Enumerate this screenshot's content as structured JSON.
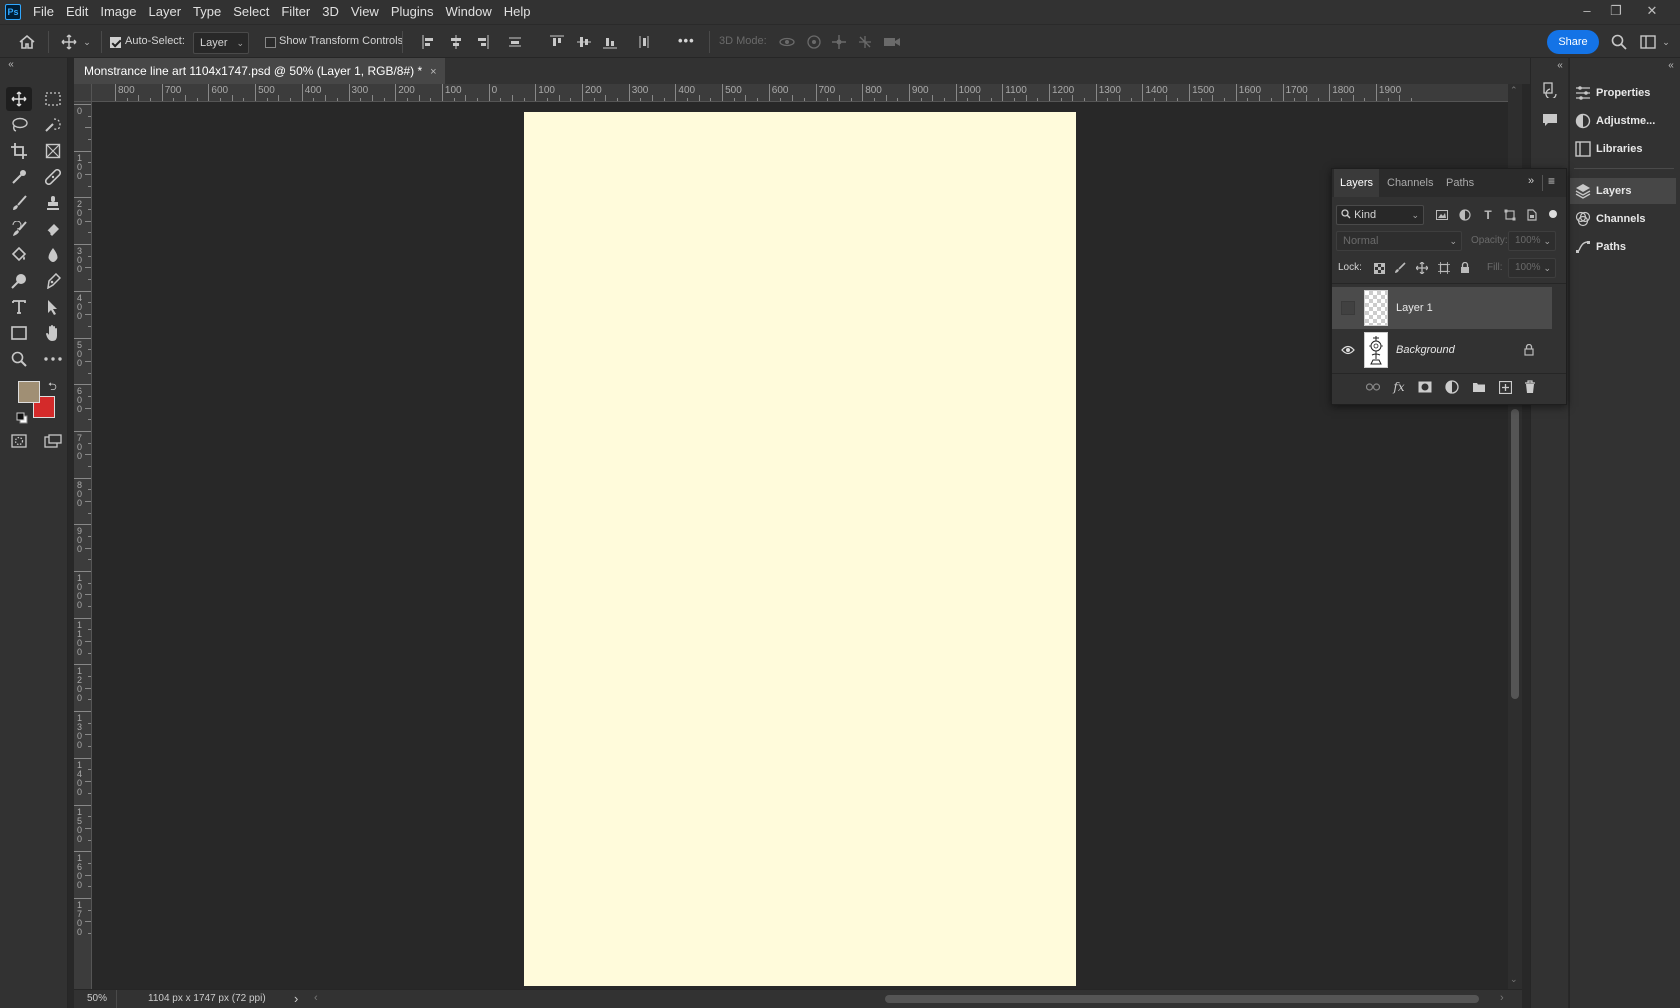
{
  "app": {
    "logo_text": "Ps"
  },
  "menu": [
    "File",
    "Edit",
    "Image",
    "Layer",
    "Type",
    "Select",
    "Filter",
    "3D",
    "View",
    "Plugins",
    "Window",
    "Help"
  ],
  "window_controls": {
    "minimize": "–",
    "restore": "❐",
    "close": "✕"
  },
  "options_bar": {
    "auto_select_label": "Auto-Select:",
    "auto_select_checked": true,
    "auto_select_target": "Layer",
    "show_transform_label": "Show Transform Controls",
    "show_transform_checked": false,
    "more_label": "•••",
    "mode_3d_label": "3D Mode:",
    "share_label": "Share"
  },
  "document": {
    "tab_title": "Monstrance line art 1104x1747.psd @ 50% (Layer 1, RGB/8#) *",
    "close_glyph": "×",
    "canvas_color": "#fffbdb"
  },
  "ruler": {
    "h_labels": [
      "800",
      "700",
      "600",
      "500",
      "400",
      "300",
      "200",
      "100",
      "0",
      "100",
      "200",
      "300",
      "400",
      "500",
      "600",
      "700",
      "800",
      "900",
      "1000",
      "1100",
      "1200",
      "1300",
      "1400",
      "1500",
      "1600",
      "1700",
      "1800",
      "1900"
    ],
    "v_labels": [
      "0",
      "100",
      "200",
      "300",
      "400",
      "500",
      "600",
      "700",
      "800",
      "900",
      "1000",
      "1100",
      "1200",
      "1300",
      "1400",
      "1500",
      "1600",
      "1700"
    ]
  },
  "status": {
    "zoom": "50%",
    "doc_info": "1104 px x 1747 px (72 ppi)",
    "arrow": "›"
  },
  "colors": {
    "foreground": "#a08f74",
    "background": "#d42a2a",
    "accent": "#1473e6"
  },
  "layers_panel": {
    "tabs": [
      "Layers",
      "Channels",
      "Paths"
    ],
    "filter_label": "Kind",
    "blend_mode": "Normal",
    "opacity_label": "Opacity:",
    "opacity_value": "100%",
    "lock_label": "Lock:",
    "fill_label": "Fill:",
    "fill_value": "100%",
    "layers": [
      {
        "name": "Layer 1",
        "visible": false,
        "selected": true,
        "locked": false
      },
      {
        "name": "Background",
        "visible": true,
        "selected": false,
        "locked": true
      }
    ]
  },
  "right_panel": {
    "items": [
      "Properties",
      "Adjustme...",
      "Libraries",
      "Layers",
      "Channels",
      "Paths"
    ]
  }
}
